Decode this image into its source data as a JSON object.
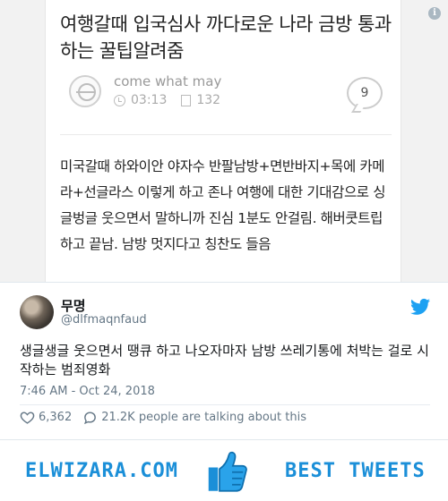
{
  "screenshot": {
    "title": "여행갈때 입국심사 까다로운 나라 금방 통과하는 꿀팁알려줌",
    "author": "come what may",
    "time": "03:13",
    "views": "132",
    "comment_count": "9",
    "body": "미국갈때 하와이안 야자수 반팔남방+면반바지+목에 카메라+선글라스 이렇게 하고 존나 여행에 대한 기대감으로 싱글벙글 웃으면서 말하니까 진심 1분도 안걸림. 해버쿳트립 하고 끝남. 남방 멋지다고 칭찬도 들음"
  },
  "info_icon": "i",
  "tweet": {
    "display_name": "무명",
    "handle": "@dlfmaqnfaud",
    "text": "생글생글 웃으면서 땡큐 하고 나오자마자 남방 쓰레기통에 처박는 걸로 시작하는 범죄영화",
    "timestamp": "7:46 AM - Oct 24, 2018",
    "likes": "6,362",
    "talking": "21.2K people are talking about this",
    "brand_color": "#1da1f2"
  },
  "banner": {
    "left_text": "ELWIZARA.COM",
    "right_text": "BEST TWEETS",
    "color": "#1b8fd8"
  },
  "icons": [
    "info-icon",
    "clock-icon",
    "document-icon",
    "comment-bubble-icon",
    "twitter-bird-icon",
    "heart-icon",
    "speech-bubble-icon",
    "thumbs-up-icon"
  ]
}
